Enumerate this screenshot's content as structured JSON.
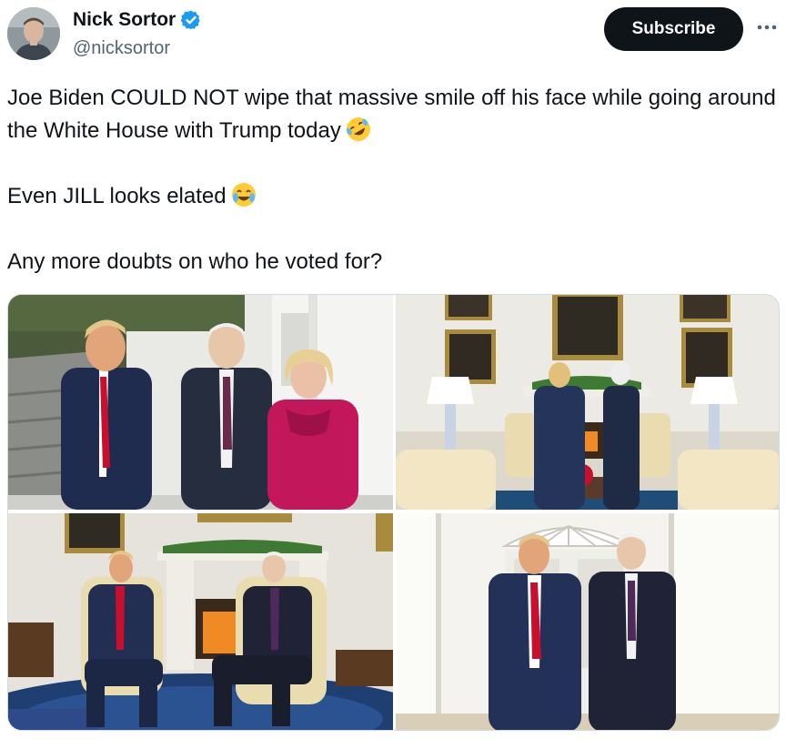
{
  "author": {
    "display_name": "Nick Sortor",
    "handle": "@nicksortor",
    "verified": true
  },
  "actions": {
    "subscribe_label": "Subscribe",
    "more_icon": "more-horizontal-icon"
  },
  "tweet": {
    "line1": "Joe Biden COULD NOT wipe that massive smile off his face while going around the White House with Trump today",
    "line1_emoji": "rolling-on-floor-laughing-emoji",
    "line2": "Even JILL looks elated",
    "line2_emoji": "tears-of-joy-emoji",
    "line3": "Any more doubts on who he voted for?"
  },
  "media": {
    "count": 4,
    "photos": [
      {
        "subject": "three-people-standing-outside-white-house"
      },
      {
        "subject": "two-men-by-oval-office-fireplace"
      },
      {
        "subject": "two-men-seated-in-oval-office"
      },
      {
        "subject": "two-men-walking-colonnade"
      }
    ]
  },
  "colors": {
    "text": "#0f1419",
    "secondary": "#536471",
    "verified": "#1d9bf0",
    "button_bg": "#0f1419",
    "border": "#cfd9de"
  }
}
